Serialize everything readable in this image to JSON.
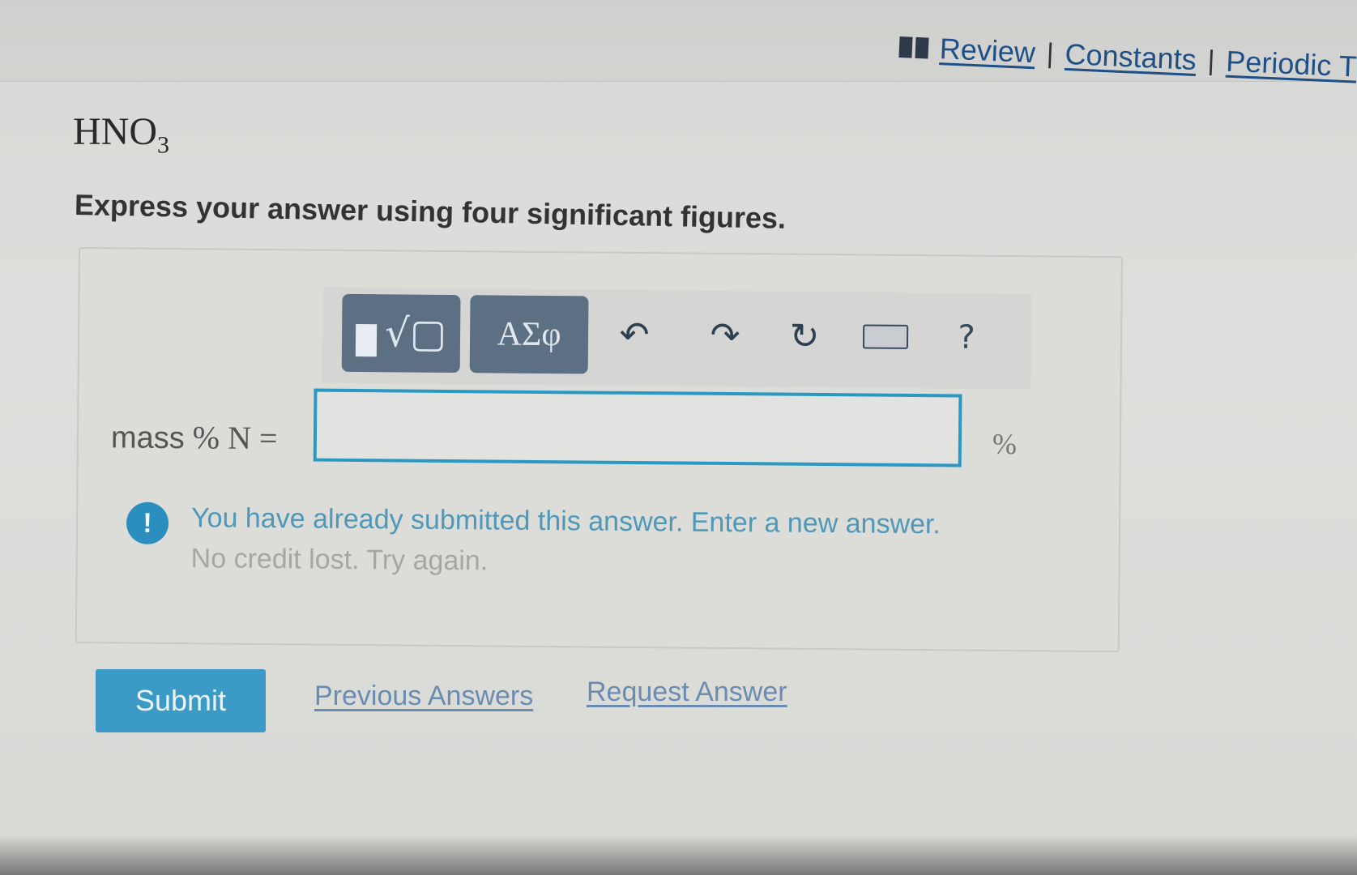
{
  "toplinks": {
    "review": "Review",
    "constants": "Constants",
    "periodic": "Periodic T",
    "separator": "|"
  },
  "problem": {
    "formula_main": "HNO",
    "formula_sub": "3",
    "instructions": "Express your answer using four significant figures."
  },
  "toolbar": {
    "templates_icon": "square-root-template-icon",
    "greek_label": "ΑΣφ",
    "undo_icon": "undo-icon",
    "redo_icon": "redo-icon",
    "reset_icon": "reset-icon",
    "keyboard_icon": "keyboard-icon",
    "help_label": "?"
  },
  "answer": {
    "label_word": "mass",
    "label_expr": "% N =",
    "value": "",
    "unit": "%"
  },
  "feedback": {
    "line1": "You have already submitted this answer. Enter a new answer.",
    "line2": "No credit lost. Try again.",
    "icon": "!"
  },
  "actions": {
    "submit": "Submit",
    "previous": "Previous Answers",
    "request": "Request Answer"
  },
  "colors": {
    "accent": "#3b9ac6",
    "link": "#1e4f86",
    "toolbar_dark": "#5c6f83"
  }
}
